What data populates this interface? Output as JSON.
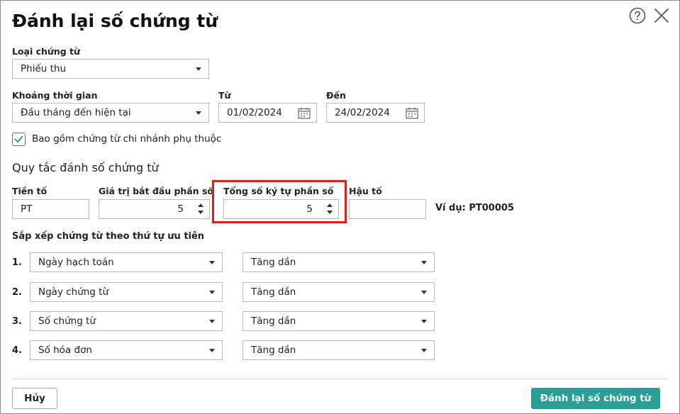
{
  "dialog": {
    "title": "Đánh lại số chứng từ",
    "help_icon": "help-circle-icon",
    "close_icon": "close-icon"
  },
  "voucher_type": {
    "label": "Loại chứng từ",
    "value": "Phiếu thu"
  },
  "period": {
    "label": "Khoảng thời gian",
    "value": "Đầu tháng đến hiện tại",
    "from_label": "Từ",
    "from_value": "01/02/2024",
    "to_label": "Đến",
    "to_value": "24/02/2024"
  },
  "include_branch": {
    "checked": true,
    "label": "Bao gồm chứng từ chi nhánh phụ thuộc"
  },
  "numbering_rule": {
    "section_title": "Quy tắc đánh số chứng từ",
    "prefix_label": "Tiền tố",
    "prefix_value": "PT",
    "start_value_label": "Giá trị bắt đầu phần số",
    "start_value": "5",
    "total_digits_label": "Tổng số ký tự phần số",
    "total_digits": "5",
    "suffix_label": "Hậu tố",
    "suffix_value": "",
    "example": "Ví dụ: PT00005"
  },
  "sort": {
    "section_title": "Sắp xếp chứng từ theo thứ tự ưu tiên",
    "rows": [
      {
        "num": "1.",
        "field": "Ngày hạch toán",
        "order": "Tăng dần"
      },
      {
        "num": "2.",
        "field": "Ngày chứng từ",
        "order": "Tăng dần"
      },
      {
        "num": "3.",
        "field": "Số chứng từ",
        "order": "Tăng dần"
      },
      {
        "num": "4.",
        "field": "Số hóa đơn",
        "order": "Tăng dần"
      }
    ]
  },
  "footer": {
    "cancel_label": "Hủy",
    "submit_label": "Đánh lại số chứng từ"
  },
  "colors": {
    "accent": "#2a9d96",
    "highlight": "#e0201d"
  }
}
